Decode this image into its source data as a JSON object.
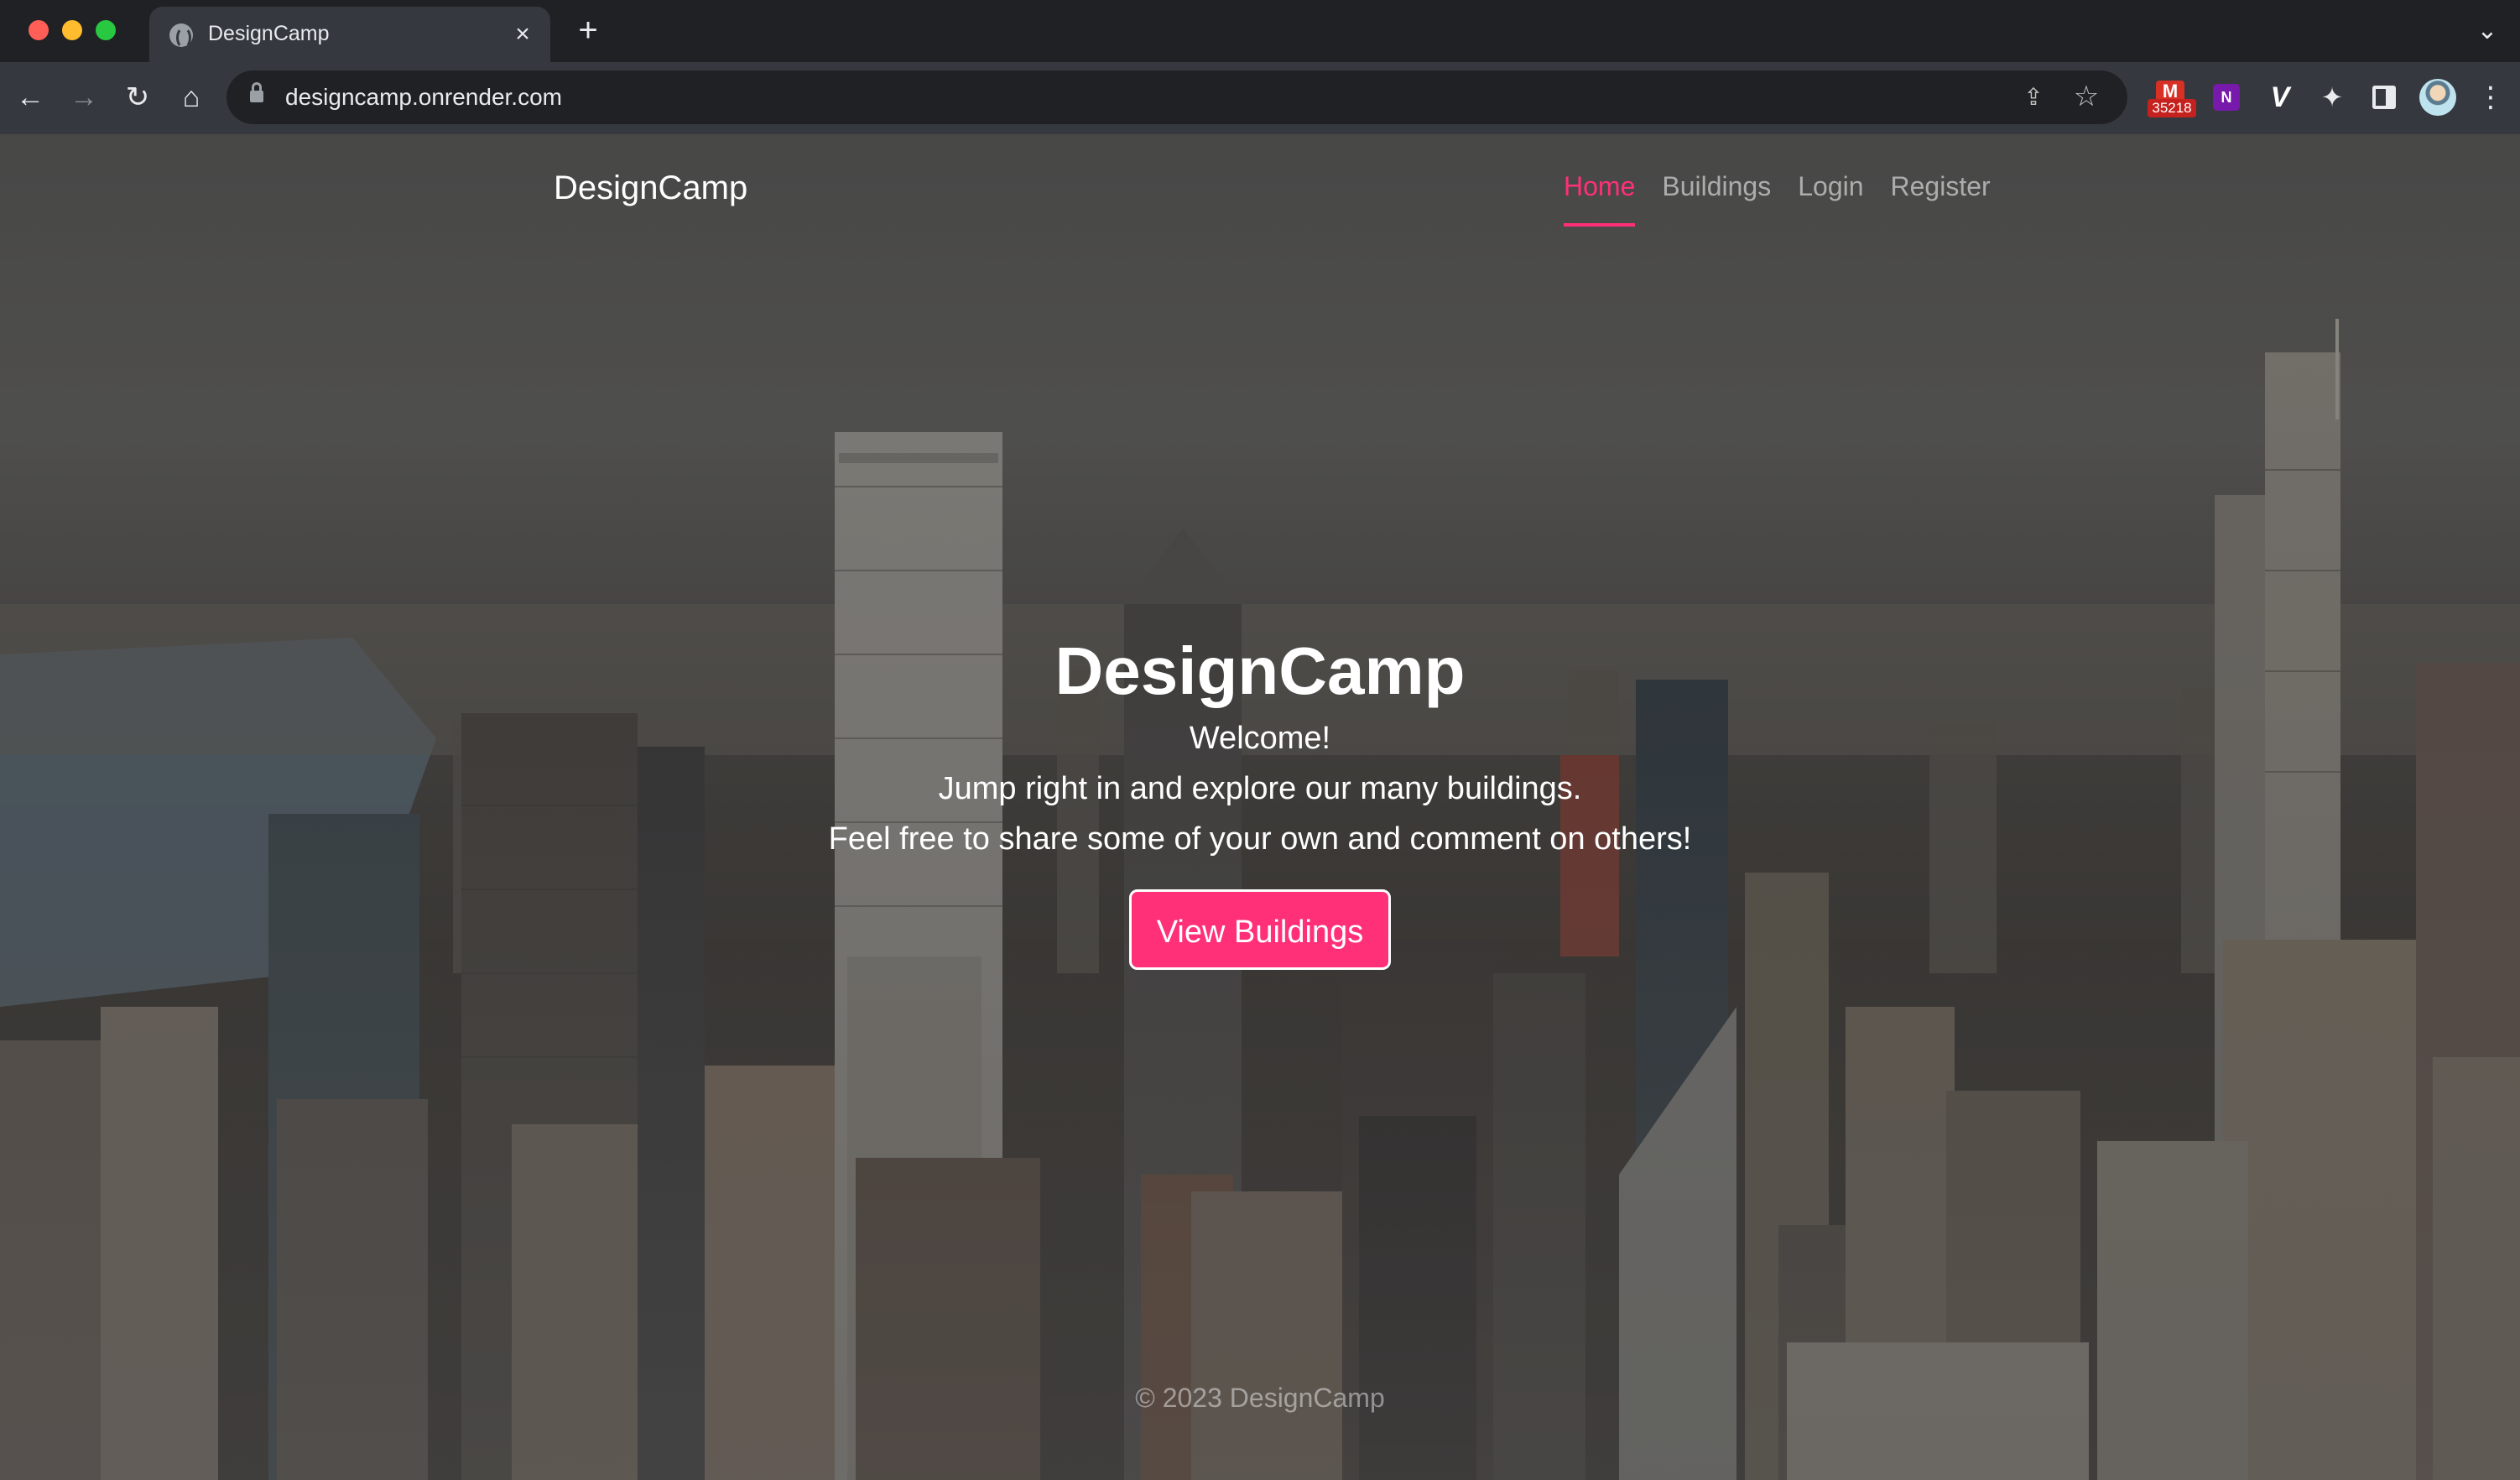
{
  "browser": {
    "tab_title": "DesignCamp",
    "tab_close": "×",
    "new_tab": "+",
    "url": "designcamp.onrender.com",
    "gmail_badge": "35218"
  },
  "nav": {
    "brand": "DesignCamp",
    "links": [
      {
        "label": "Home",
        "active": true
      },
      {
        "label": "Buildings",
        "active": false
      },
      {
        "label": "Login",
        "active": false
      },
      {
        "label": "Register",
        "active": false
      }
    ]
  },
  "hero": {
    "title": "DesignCamp",
    "lines": [
      "Welcome!",
      "Jump right in and explore our many buildings.",
      "Feel free to share some of your own and comment on others!"
    ],
    "cta_label": "View Buildings"
  },
  "footer": {
    "text": "© 2023 DesignCamp"
  },
  "colors": {
    "accent": "#ff2f78",
    "chrome_dark": "#202124",
    "chrome_toolbar": "#35393f"
  }
}
